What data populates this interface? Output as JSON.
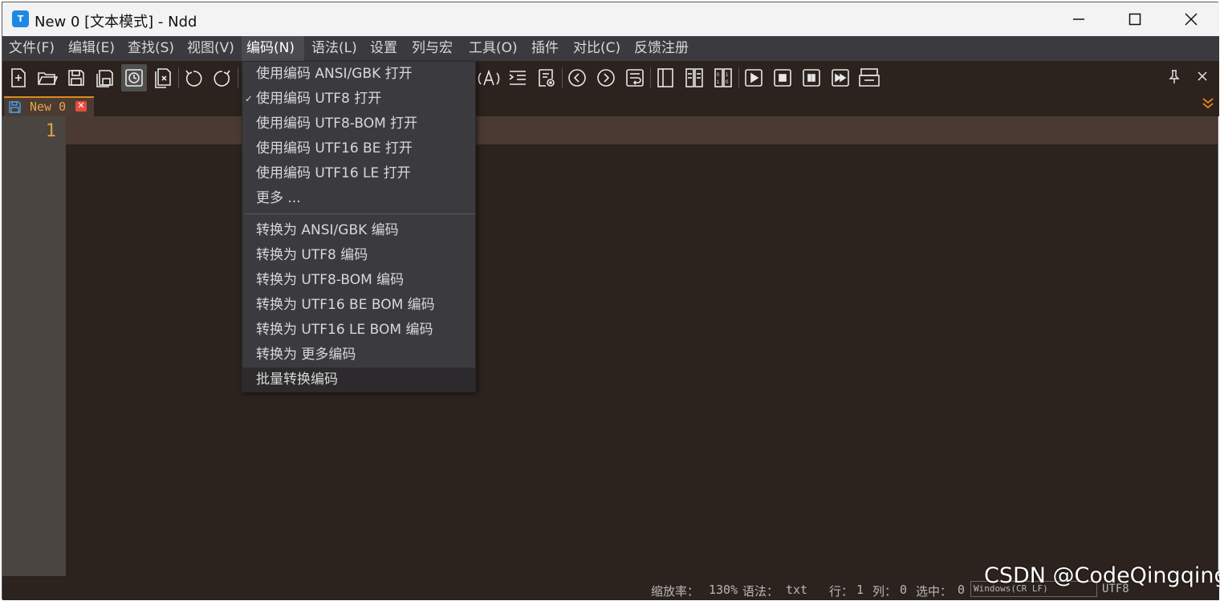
{
  "window": {
    "title": "New 0 [文本模式] - Ndd",
    "app_icon_letter": "T"
  },
  "menubar": {
    "items": [
      {
        "label": "文件(F)"
      },
      {
        "label": "编辑(E)"
      },
      {
        "label": "查找(S)"
      },
      {
        "label": "视图(V)"
      },
      {
        "label": "编码(N)",
        "active": true
      },
      {
        "label": "语法(L)"
      },
      {
        "label": "设置"
      },
      {
        "label": "列与宏"
      },
      {
        "label": "工具(O)"
      },
      {
        "label": "插件"
      },
      {
        "label": "对比(C)"
      },
      {
        "label": "反馈注册"
      }
    ]
  },
  "encoding_menu": {
    "items": [
      {
        "label": "使用编码 ANSI/GBK 打开",
        "checked": false
      },
      {
        "label": "使用编码 UTF8 打开",
        "checked": true
      },
      {
        "label": "使用编码 UTF8-BOM 打开",
        "checked": false
      },
      {
        "label": "使用编码 UTF16 BE 打开",
        "checked": false
      },
      {
        "label": "使用编码 UTF16 LE 打开",
        "checked": false
      },
      {
        "label": "更多 ...",
        "checked": false
      },
      {
        "label": "转换为 ANSI/GBK 编码",
        "checked": false
      },
      {
        "label": "转换为 UTF8 编码",
        "checked": false
      },
      {
        "label": "转换为 UTF8-BOM 编码",
        "checked": false
      },
      {
        "label": "转换为 UTF16 BE BOM 编码",
        "checked": false
      },
      {
        "label": "转换为 UTF16 LE BOM 编码",
        "checked": false
      },
      {
        "label": "转换为 更多编码",
        "checked": false
      },
      {
        "label": "批量转换编码",
        "checked": false,
        "highlight": true
      }
    ],
    "check_mark": "✓"
  },
  "tab": {
    "label": "New 0",
    "close_glyph": "✕"
  },
  "editor": {
    "line_numbers": [
      "1"
    ]
  },
  "statusbar": {
    "zoom_label": "缩放率：",
    "zoom_value": "130%",
    "syntax_label": "语法：",
    "syntax_value": "txt",
    "row_label": "行：",
    "row_value": "1",
    "col_label": "列：",
    "col_value": "0",
    "sel_label": "选中：",
    "sel_value": "0",
    "eol": "Windows(CR LF)",
    "encoding": "UTF8"
  },
  "watermark": "CSDN @CodeQingqing",
  "colors": {
    "editor_bg": "#2c221e",
    "menu_bg": "#3b3b3f",
    "accent_orange": "#e08a1e",
    "line_number": "#e0a040"
  }
}
